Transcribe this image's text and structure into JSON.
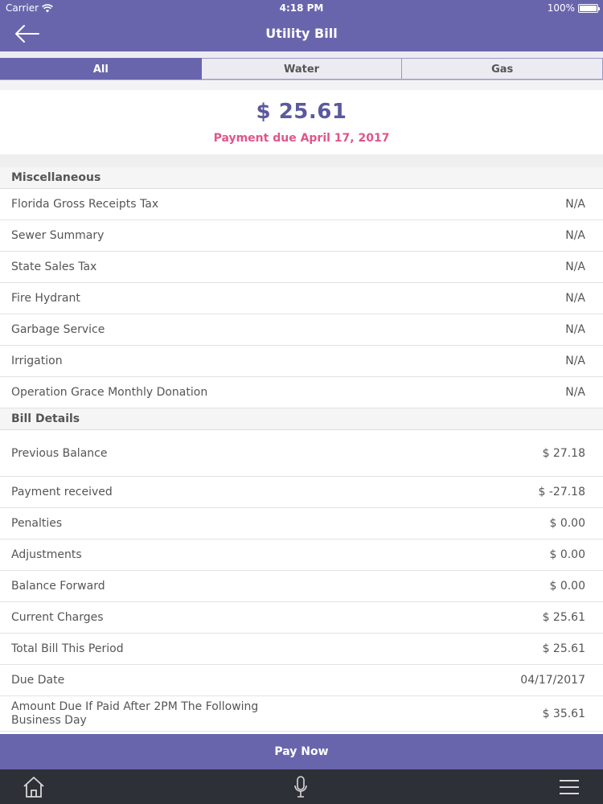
{
  "status": {
    "carrier": "Carrier",
    "time": "4:18 PM",
    "battery": "100%",
    "battery_level": 1.0
  },
  "nav": {
    "title": "Utility Bill",
    "back_icon": "back-arrow-icon"
  },
  "tabs": [
    {
      "label": "All",
      "active": true
    },
    {
      "label": "Water",
      "active": false
    },
    {
      "label": "Gas",
      "active": false
    }
  ],
  "summary": {
    "amount": "$ 25.61",
    "due": "Payment due April 17, 2017"
  },
  "sections": {
    "misc": {
      "title": "Miscellaneous",
      "rows": [
        {
          "label": "Florida Gross Receipts Tax",
          "value": "N/A"
        },
        {
          "label": "Sewer Summary",
          "value": "N/A"
        },
        {
          "label": "State Sales Tax",
          "value": "N/A"
        },
        {
          "label": "Fire Hydrant",
          "value": "N/A"
        },
        {
          "label": "Garbage Service",
          "value": "N/A"
        },
        {
          "label": "Irrigation",
          "value": "N/A"
        },
        {
          "label": "Operation Grace Monthly Donation",
          "value": "N/A"
        }
      ]
    },
    "bill": {
      "title": "Bill Details",
      "rows": [
        {
          "label": "Previous Balance",
          "value": "$ 27.18"
        },
        {
          "label": "Payment received",
          "value": "$ -27.18"
        },
        {
          "label": "Penalties",
          "value": "$ 0.00"
        },
        {
          "label": "Adjustments",
          "value": "$ 0.00"
        },
        {
          "label": "Balance Forward",
          "value": "$ 0.00"
        },
        {
          "label": "Current Charges",
          "value": "$ 25.61"
        },
        {
          "label": "Total Bill This Period",
          "value": "$ 25.61"
        },
        {
          "label": "Due Date",
          "value": "04/17/2017"
        },
        {
          "label": "Amount Due If Paid After 2PM The Following Business Day",
          "value": "$ 35.61"
        }
      ]
    }
  },
  "pay_now": "Pay Now",
  "bottom_icons": [
    "home-icon",
    "microphone-icon",
    "menu-icon"
  ],
  "colors": {
    "brand": "#6965ad",
    "due_text": "#e0558a",
    "amount_text": "#5b599e",
    "bottom_bar": "#2e3037"
  }
}
